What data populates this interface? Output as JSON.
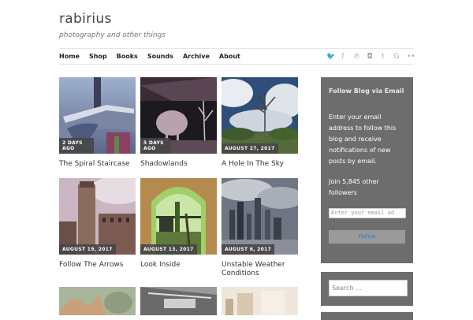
{
  "site": {
    "title": "rabirius",
    "tagline": "photography and other things"
  },
  "nav": [
    "Home",
    "Shop",
    "Books",
    "Sounds",
    "Archive",
    "About"
  ],
  "social": [
    {
      "name": "twitter-icon",
      "glyph": "🐦"
    },
    {
      "name": "facebook-icon",
      "glyph": "f"
    },
    {
      "name": "pinterest-icon",
      "glyph": "℗"
    },
    {
      "name": "instagram-icon",
      "glyph": "◘"
    },
    {
      "name": "tumblr-icon",
      "glyph": "t"
    },
    {
      "name": "googleplus-icon",
      "glyph": "G"
    },
    {
      "name": "flickr-icon",
      "glyph": "••"
    }
  ],
  "posts": [
    {
      "date": "2 DAYS AGO",
      "title": "The Spiral Staircase"
    },
    {
      "date": "5 DAYS AGO",
      "title": "Shadowlands"
    },
    {
      "date": "AUGUST 27, 2017",
      "title": "A Hole In The Sky"
    },
    {
      "date": "AUGUST 19, 2017",
      "title": "Follow The Arrows"
    },
    {
      "date": "AUGUST 13, 2017",
      "title": "Look Inside"
    },
    {
      "date": "AUGUST 6, 2017",
      "title": "Unstable Weather Conditions"
    },
    {
      "date": "",
      "title": ""
    },
    {
      "date": "",
      "title": ""
    },
    {
      "date": "",
      "title": ""
    }
  ],
  "sidebar": {
    "follow_title": "Follow Blog via Email",
    "follow_text": "Enter your email address to follow this blog and receive notifications of new posts by email.",
    "followers": "Join 5,845 other followers",
    "email_placeholder": "Enter your email ad",
    "follow_button": "Follow",
    "search_placeholder": "Search …"
  },
  "colors": {
    "sidebar_bg": "#6d6d6d",
    "date_badge": "#464646",
    "follow_link": "#2f7fbf"
  }
}
